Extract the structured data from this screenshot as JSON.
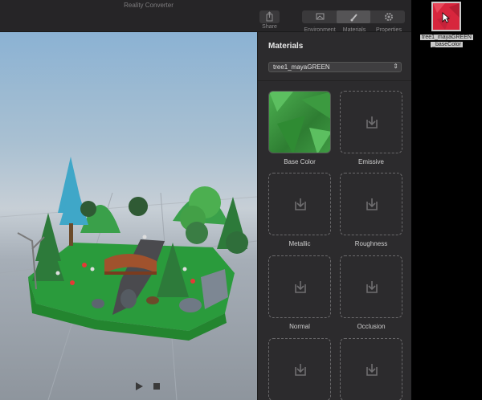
{
  "window": {
    "title": "Reality Converter"
  },
  "toolbar": {
    "share_label": "Share",
    "environment_label": "Environment",
    "materials_label": "Materials",
    "properties_label": "Properties",
    "active_segment": "Materials"
  },
  "viewport": {
    "play_icon": "play-icon",
    "stop_icon": "stop-icon"
  },
  "panel": {
    "heading": "Materials",
    "material_select": {
      "selected": "tree1_mayaGREEN"
    },
    "slots": [
      {
        "label": "Base Color",
        "filled": true
      },
      {
        "label": "Emissive",
        "filled": false
      },
      {
        "label": "Metallic",
        "filled": false
      },
      {
        "label": "Roughness",
        "filled": false
      },
      {
        "label": "Normal",
        "filled": false
      },
      {
        "label": "Occlusion",
        "filled": false
      },
      {
        "label": "",
        "filled": false
      },
      {
        "label": "",
        "filled": false
      }
    ]
  },
  "desktop": {
    "file_label_line1": "tree1_mayaGREEN",
    "file_label_line2": "_baseColor"
  },
  "colors": {
    "texture_red": "#d7263d",
    "texture_green": "#4caf50",
    "window_bg": "#2b2a2c"
  }
}
